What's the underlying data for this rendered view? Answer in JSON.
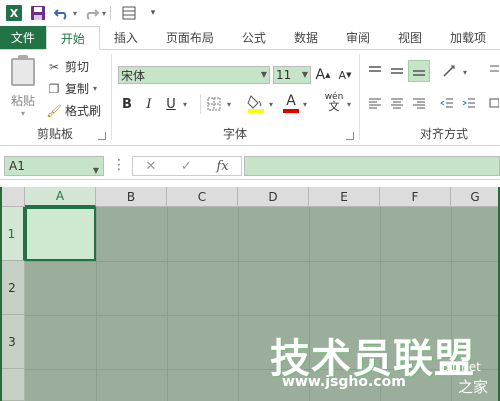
{
  "qat": {
    "app_logo": "X",
    "save_icon": "save-icon",
    "undo_icon": "undo-icon",
    "redo_icon": "redo-icon",
    "form_icon": "form-icon",
    "more_icon": "customize-icon"
  },
  "tabs": [
    {
      "label": "文件"
    },
    {
      "label": "开始"
    },
    {
      "label": "插入"
    },
    {
      "label": "页面布局"
    },
    {
      "label": "公式"
    },
    {
      "label": "数据"
    },
    {
      "label": "审阅"
    },
    {
      "label": "视图"
    },
    {
      "label": "加载项"
    }
  ],
  "ribbon": {
    "clipboard": {
      "paste_label": "粘贴",
      "cut_label": "剪切",
      "copy_label": "复制",
      "format_painter_label": "格式刷",
      "group_label": "剪贴板"
    },
    "font": {
      "font_name": "宋体",
      "font_size": "11",
      "increase_label": "A",
      "decrease_label": "A",
      "bold": "B",
      "italic": "I",
      "underline": "U",
      "font_color_label": "A",
      "wen": "wén",
      "wen_char": "文",
      "group_label": "字体"
    },
    "align": {
      "group_label": "对齐方式"
    }
  },
  "formula_bar": {
    "name_box": "A1",
    "fx": "fx",
    "cancel": "✕",
    "enter": "✓",
    "value": ""
  },
  "grid": {
    "columns": [
      "A",
      "B",
      "C",
      "D",
      "E",
      "F",
      "G"
    ],
    "rows": [
      "1",
      "2",
      "3"
    ]
  },
  "watermark": {
    "main": "技术员联盟",
    "url": "www.jsgho.com",
    "side": "51.net",
    "home": "之家"
  },
  "colors": {
    "accent": "#217346",
    "selected_fill": "#c6e5c8",
    "dim_grid": "#9aae9b"
  }
}
